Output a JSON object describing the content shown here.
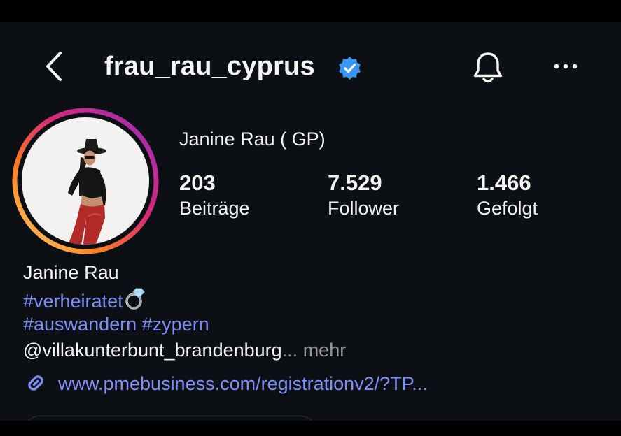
{
  "header": {
    "username": "frau_rau_cyprus",
    "icons": [
      "back-icon",
      "verified-badge-icon",
      "bell-icon",
      "more-icon"
    ]
  },
  "profile": {
    "display_name": "Janine Rau ( GP)",
    "stats": {
      "posts": {
        "value": "203",
        "label": "Beiträge"
      },
      "followers": {
        "value": "7.529",
        "label": "Follower"
      },
      "following": {
        "value": "1.466",
        "label": "Gefolgt"
      }
    }
  },
  "bio": {
    "name": "Janine Rau",
    "hashtag1": "#verheiratet",
    "hashtag2": "#auswandern",
    "hashtag3": "#zypern",
    "mention": "@villakunterbunt_brandenburg",
    "ellipsis": "...",
    "more": "mehr"
  },
  "link": {
    "url": "www.pmebusiness.com/registrationv2/?TP..."
  },
  "colors": {
    "background": "#0c0f14",
    "accent_link": "#7d8ff5",
    "verified_blue": "#3897f0"
  }
}
